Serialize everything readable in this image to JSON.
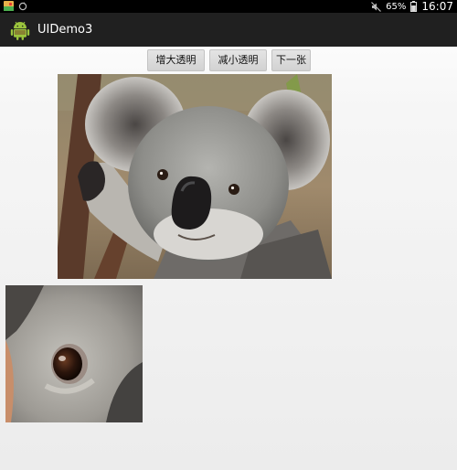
{
  "status_bar": {
    "icons_left": [
      "gallery-icon",
      "sync-icon"
    ],
    "icons_right": [
      "mute-icon",
      "battery-icon"
    ],
    "battery_percent": "65%",
    "time": "16:07"
  },
  "action_bar": {
    "app_icon": "android-icon",
    "title": "UIDemo3"
  },
  "buttons": {
    "increase_alpha": "增大透明度",
    "decrease_alpha": "减小透明度",
    "next": "下一张"
  },
  "images": {
    "main": "koala-image",
    "zoom": "koala-eye-zoom"
  }
}
